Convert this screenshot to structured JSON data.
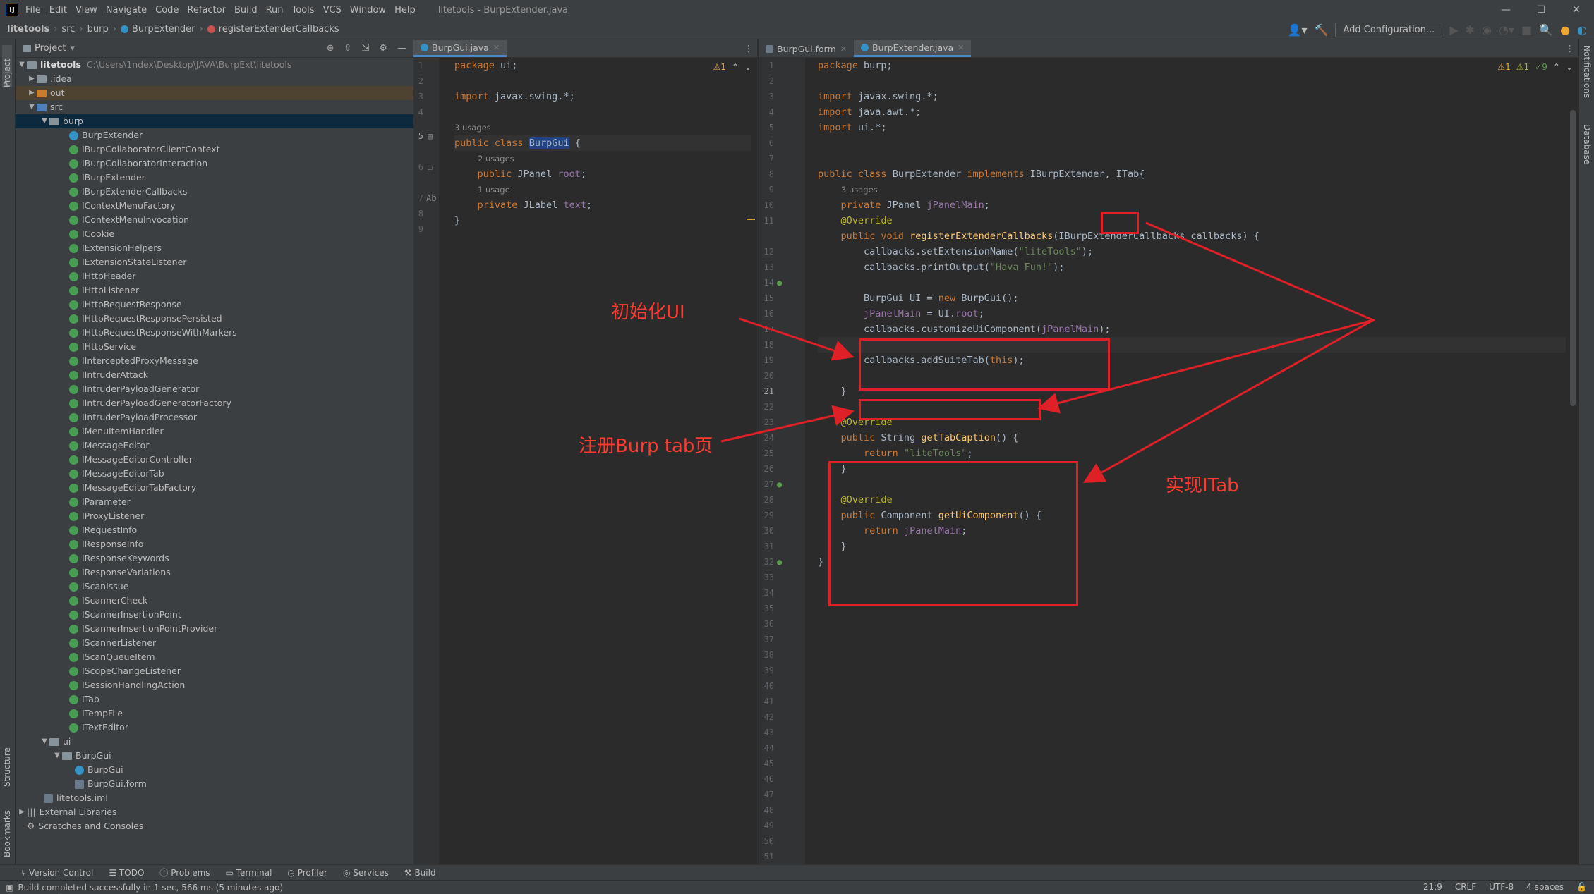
{
  "window": {
    "title": "litetools - BurpExtender.java"
  },
  "menu": [
    "File",
    "Edit",
    "View",
    "Navigate",
    "Code",
    "Refactor",
    "Build",
    "Run",
    "Tools",
    "VCS",
    "Window",
    "Help"
  ],
  "breadcrumb": [
    "litetools",
    "src",
    "burp",
    "BurpExtender",
    "registerExtenderCallbacks"
  ],
  "toolbar": {
    "add_config": "Add Configuration..."
  },
  "project": {
    "header": "Project",
    "root": "litetools",
    "root_path": "C:\\Users\\1ndex\\Desktop\\JAVA\\BurpExt\\litetools",
    "idea": ".idea",
    "out": "out",
    "src": "src",
    "burp": "burp",
    "classes": [
      "BurpExtender",
      "IBurpCollaboratorClientContext",
      "IBurpCollaboratorInteraction",
      "IBurpExtender",
      "IBurpExtenderCallbacks",
      "IContextMenuFactory",
      "IContextMenuInvocation",
      "ICookie",
      "IExtensionHelpers",
      "IExtensionStateListener",
      "IHttpHeader",
      "IHttpListener",
      "IHttpRequestResponse",
      "IHttpRequestResponsePersisted",
      "IHttpRequestResponseWithMarkers",
      "IHttpService",
      "IInterceptedProxyMessage",
      "IIntruderAttack",
      "IIntruderPayloadGenerator",
      "IIntruderPayloadGeneratorFactory",
      "IIntruderPayloadProcessor",
      "IMenuItemHandler",
      "IMessageEditor",
      "IMessageEditorController",
      "IMessageEditorTab",
      "IMessageEditorTabFactory",
      "IParameter",
      "IProxyListener",
      "IRequestInfo",
      "IResponseInfo",
      "IResponseKeywords",
      "IResponseVariations",
      "IScanIssue",
      "IScannerCheck",
      "IScannerInsertionPoint",
      "IScannerInsertionPointProvider",
      "IScannerListener",
      "IScanQueueItem",
      "IScopeChangeListener",
      "ISessionHandlingAction",
      "ITab",
      "ITempFile",
      "ITextEditor"
    ],
    "ui": "ui",
    "burpgui_pkg": "BurpGui",
    "burpgui_class": "BurpGui",
    "burpgui_form": "BurpGui.form",
    "iml": "litetools.iml",
    "ext_libs": "External Libraries",
    "scratches": "Scratches and Consoles"
  },
  "left_editor": {
    "tabs": [
      "BurpGui.java"
    ],
    "inspections": "⚠1",
    "lines": [
      "1",
      "2",
      "3",
      "4",
      "5",
      "6",
      "7",
      "8",
      "9"
    ]
  },
  "right_editor": {
    "tabs": [
      "BurpGui.form",
      "BurpExtender.java"
    ],
    "inspections": {
      "warn": "⚠1",
      "weak": "⚠1",
      "ok": "✓9"
    }
  },
  "annotations": {
    "init_ui": "初始化UI",
    "register_tab": "注册Burp tab页",
    "impl_itab": "实现ITab"
  },
  "bottom_tools": [
    "Version Control",
    "TODO",
    "Problems",
    "Terminal",
    "Profiler",
    "Services",
    "Build"
  ],
  "status": {
    "message": "Build completed successfully in 1 sec, 566 ms (5 minutes ago)",
    "position": "21:9",
    "line_sep": "CRLF",
    "encoding": "UTF-8",
    "indent": "4 spaces"
  },
  "side_tools": {
    "left_top": "Project",
    "left_mid": "Structure",
    "left_bottom": "Bookmarks",
    "right_top": "Notifications",
    "right_mid": "Database"
  }
}
